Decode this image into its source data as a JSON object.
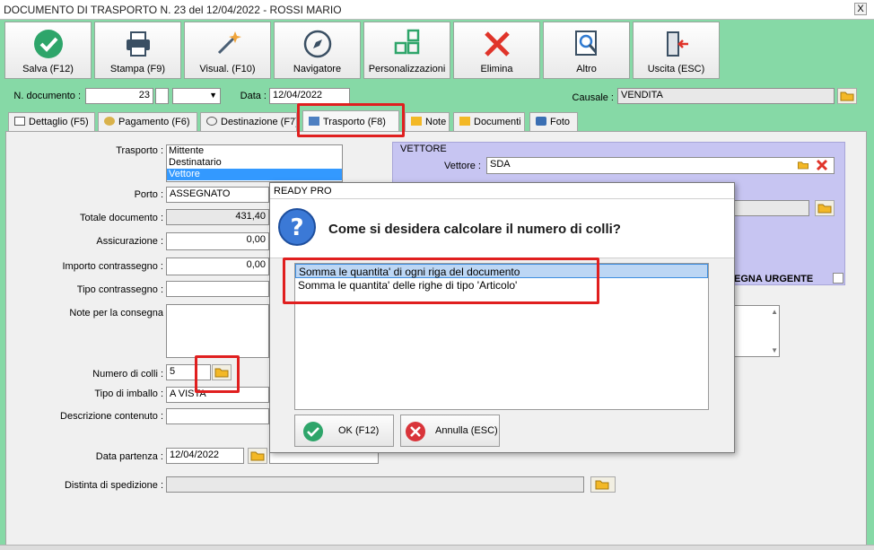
{
  "window": {
    "title": "DOCUMENTO DI TRASPORTO N. 23 del 12/04/2022 - ROSSI MARIO",
    "close_glyph": "X"
  },
  "toolbar": [
    {
      "label": "Salva (F12)",
      "icon": "check-icon"
    },
    {
      "label": "Stampa (F9)",
      "icon": "printer-icon"
    },
    {
      "label": "Visual. (F10)",
      "icon": "magic-wand-icon"
    },
    {
      "label": "Navigatore",
      "icon": "compass-icon"
    },
    {
      "label": "Personalizzazioni",
      "icon": "grid-icon"
    },
    {
      "label": "Elimina",
      "icon": "delete-x-icon"
    },
    {
      "label": "Altro",
      "icon": "magnifier-icon"
    },
    {
      "label": "Uscita (ESC)",
      "icon": "exit-door-icon"
    }
  ],
  "header": {
    "doc_number_label": "N. documento :",
    "doc_number": "23",
    "date_label": "Data :",
    "date": "12/04/2022",
    "causale_label": "Causale :",
    "causale": "VENDITA"
  },
  "tabs": [
    {
      "label": "Dettaglio (F5)",
      "icon": "table-icon"
    },
    {
      "label": "Pagamento (F6)",
      "icon": "coins-icon"
    },
    {
      "label": "Destinazione (F7)",
      "icon": "globe-icon"
    },
    {
      "label": "Trasporto (F8)",
      "icon": "truck-icon"
    },
    {
      "label": "Note",
      "icon": "folder-icon"
    },
    {
      "label": "Documenti",
      "icon": "folder-icon"
    },
    {
      "label": "Foto",
      "icon": "camera-icon"
    }
  ],
  "form": {
    "trasporto_label": "Trasporto :",
    "trasporto_options": [
      "Mittente",
      "Destinatario",
      "Vettore"
    ],
    "trasporto_selected": "Vettore",
    "porto_label": "Porto :",
    "porto": "ASSEGNATO",
    "totale_label": "Totale documento :",
    "totale": "431,40",
    "assicurazione_label": "Assicurazione :",
    "assicurazione": "0,00",
    "contrassegno_label": "Importo contrassegno :",
    "contrassegno": "0,00",
    "tipo_contrassegno_label": "Tipo contrassegno :",
    "note_label": "Note per la consegna",
    "colli_label": "Numero di colli :",
    "colli": "5",
    "imballo_label": "Tipo di imballo :",
    "imballo": "A VISTA",
    "descrizione_label": "Descrizione contenuto :",
    "data_partenza_label": "Data partenza :",
    "data_partenza": "12/04/2022",
    "distinta_label": "Distinta di spedizione :",
    "vettore_group_label": "VETTORE",
    "vettore_label": "Vettore :",
    "vettore": "SDA",
    "consegna_urgente_label": "EGNA URGENTE"
  },
  "dialog": {
    "title": "READY PRO",
    "question": "Come si desidera calcolare il numero di colli?",
    "options": [
      "Somma le quantita' di ogni riga del documento",
      "Somma le quantita' delle righe di tipo 'Articolo'"
    ],
    "ok_label": "OK (F12)",
    "cancel_label": "Annulla (ESC)"
  },
  "colors": {
    "background": "#86d9a6",
    "highlight": "#e01f1f",
    "selection": "#3399ff",
    "vettore_panel": "#c7c5f2"
  }
}
